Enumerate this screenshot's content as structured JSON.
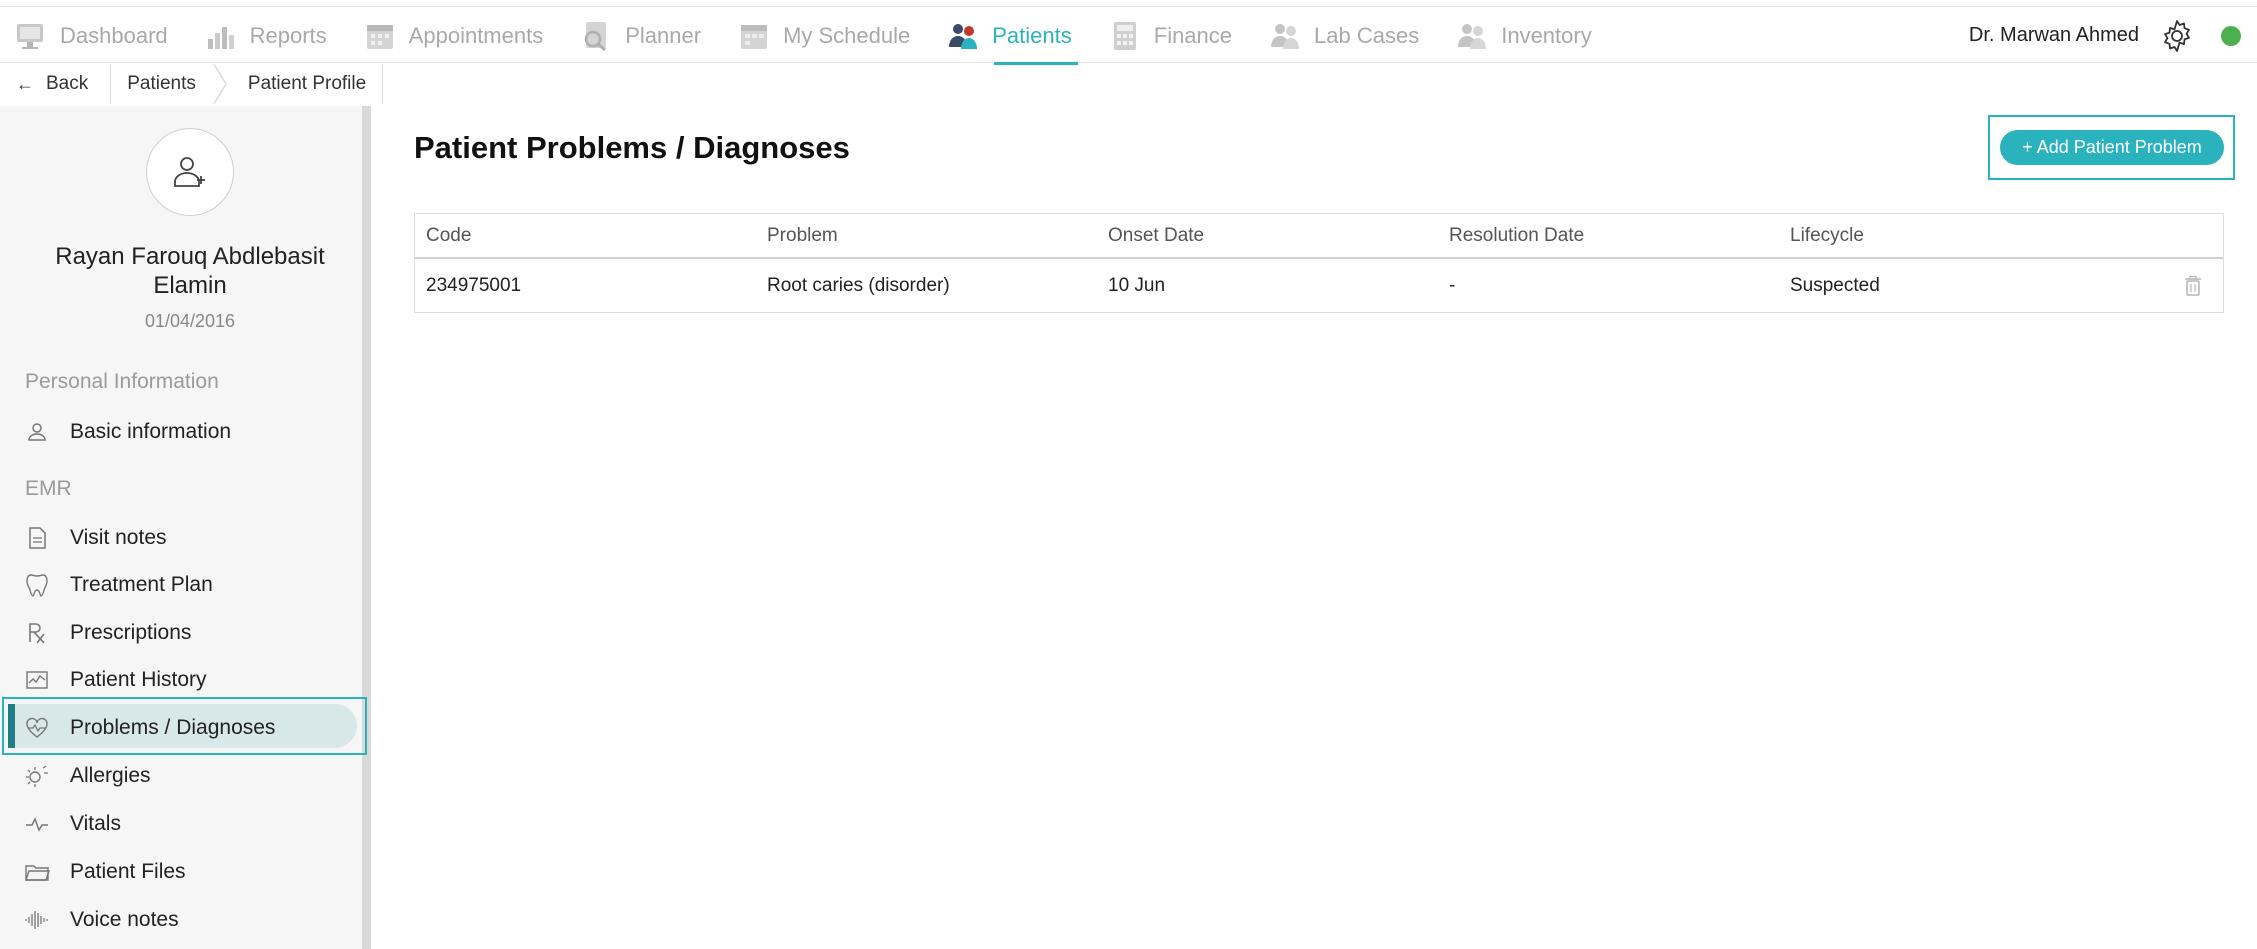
{
  "nav": {
    "items": [
      {
        "label": "Dashboard",
        "icon": "dashboard-icon"
      },
      {
        "label": "Reports",
        "icon": "reports-icon"
      },
      {
        "label": "Appointments",
        "icon": "appointments-icon"
      },
      {
        "label": "Planner",
        "icon": "planner-icon"
      },
      {
        "label": "My Schedule",
        "icon": "schedule-icon"
      },
      {
        "label": "Patients",
        "icon": "patients-icon"
      },
      {
        "label": "Finance",
        "icon": "finance-icon"
      },
      {
        "label": "Lab Cases",
        "icon": "lab-cases-icon"
      },
      {
        "label": "Inventory",
        "icon": "inventory-icon"
      }
    ],
    "active": "Patients",
    "user_name": "Dr. Marwan Ahmed",
    "accent_color": "#2ab3bd",
    "status_color": "#4caf50"
  },
  "breadcrumb": {
    "back": "Back",
    "items": [
      "Patients",
      "Patient Profile"
    ]
  },
  "patient": {
    "name": "Rayan Farouq Abdlebasit Elamin",
    "dob": "01/04/2016"
  },
  "sidebar": {
    "sections": [
      {
        "title": "Personal Information"
      },
      {
        "title": "EMR"
      }
    ],
    "items": [
      {
        "label": "Basic information",
        "icon": "user-icon"
      },
      {
        "label": "Visit notes",
        "icon": "document-icon"
      },
      {
        "label": "Treatment Plan",
        "icon": "tooth-icon"
      },
      {
        "label": "Prescriptions",
        "icon": "prescription-icon"
      },
      {
        "label": "Patient History",
        "icon": "history-chart-icon"
      },
      {
        "label": "Problems / Diagnoses",
        "icon": "heart-pulse-icon"
      },
      {
        "label": "Allergies",
        "icon": "allergy-icon"
      },
      {
        "label": "Vitals",
        "icon": "vitals-icon"
      },
      {
        "label": "Patient Files",
        "icon": "folder-icon"
      },
      {
        "label": "Voice notes",
        "icon": "waveform-icon"
      }
    ],
    "active_item": "Problems / Diagnoses"
  },
  "main": {
    "title": "Patient Problems / Diagnoses",
    "add_button": "+ Add Patient Problem",
    "table": {
      "headers": [
        "Code",
        "Problem",
        "Onset Date",
        "Resolution Date",
        "Lifecycle"
      ],
      "rows": [
        [
          "234975001",
          "Root caries (disorder)",
          "10 Jun",
          "-",
          "Suspected"
        ]
      ]
    }
  }
}
